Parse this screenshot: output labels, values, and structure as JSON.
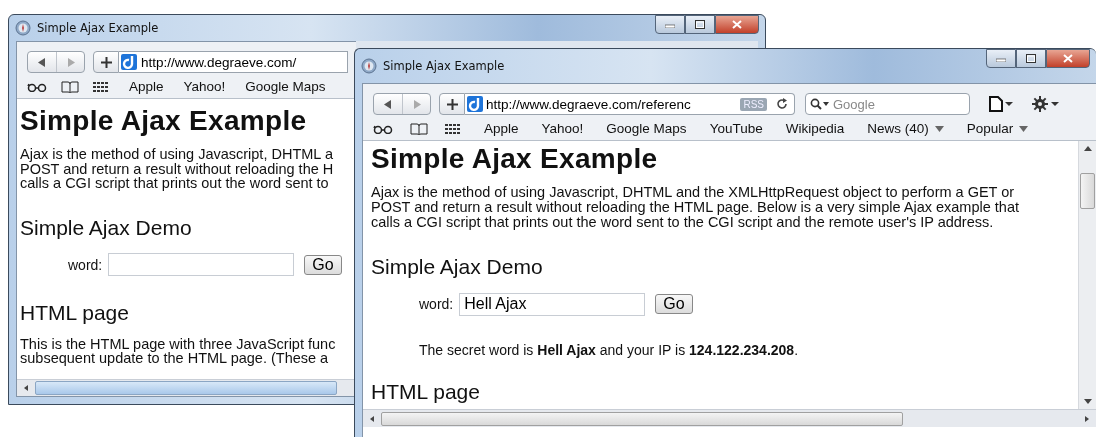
{
  "back_window": {
    "title": "Simple Ajax Example",
    "url": "http://www.degraeve.com/",
    "bookmarks": [
      "Apple",
      "Yahoo!",
      "Google Maps"
    ],
    "page": {
      "heading": "Simple Ajax Example",
      "intro_lines": [
        "Ajax is the method of using Javascript, DHTML a",
        "POST and return a result without reloading the H",
        "calls a CGI script that prints out the word sent to"
      ],
      "demo_heading": "Simple Ajax Demo",
      "word_label": "word:",
      "go_button": "Go",
      "section_heading": "HTML page",
      "section_lines": [
        "This is the HTML page with three JavaScript func",
        "subsequent update to the HTML page. (These a"
      ]
    }
  },
  "front_window": {
    "title": "Simple Ajax Example",
    "url": "http://www.degraeve.com/referenc",
    "rss_badge": "RSS",
    "search": {
      "placeholder": "Google"
    },
    "bookmarks": [
      {
        "label": "Apple",
        "menu": false
      },
      {
        "label": "Yahoo!",
        "menu": false
      },
      {
        "label": "Google Maps",
        "menu": false
      },
      {
        "label": "YouTube",
        "menu": false
      },
      {
        "label": "Wikipedia",
        "menu": false
      },
      {
        "label": "News (40)",
        "menu": true
      },
      {
        "label": "Popular",
        "menu": true
      }
    ],
    "page": {
      "heading": "Simple Ajax Example",
      "intro": "Ajax is the method of using Javascript, DHTML and the XMLHttpRequest object to perform a GET or POST and return a result without reloading the HTML page. Below is a very simple Ajax example that calls a CGI script that prints out the word sent to the CGI script and the remote user's IP address.",
      "demo_heading": "Simple Ajax Demo",
      "word_label": "word:",
      "word_value": "Hell Ajax",
      "go_button": "Go",
      "result": "The secret word is **Hell Ajax** and your IP is **124.122.234.208**.",
      "section_heading": "HTML page"
    }
  }
}
